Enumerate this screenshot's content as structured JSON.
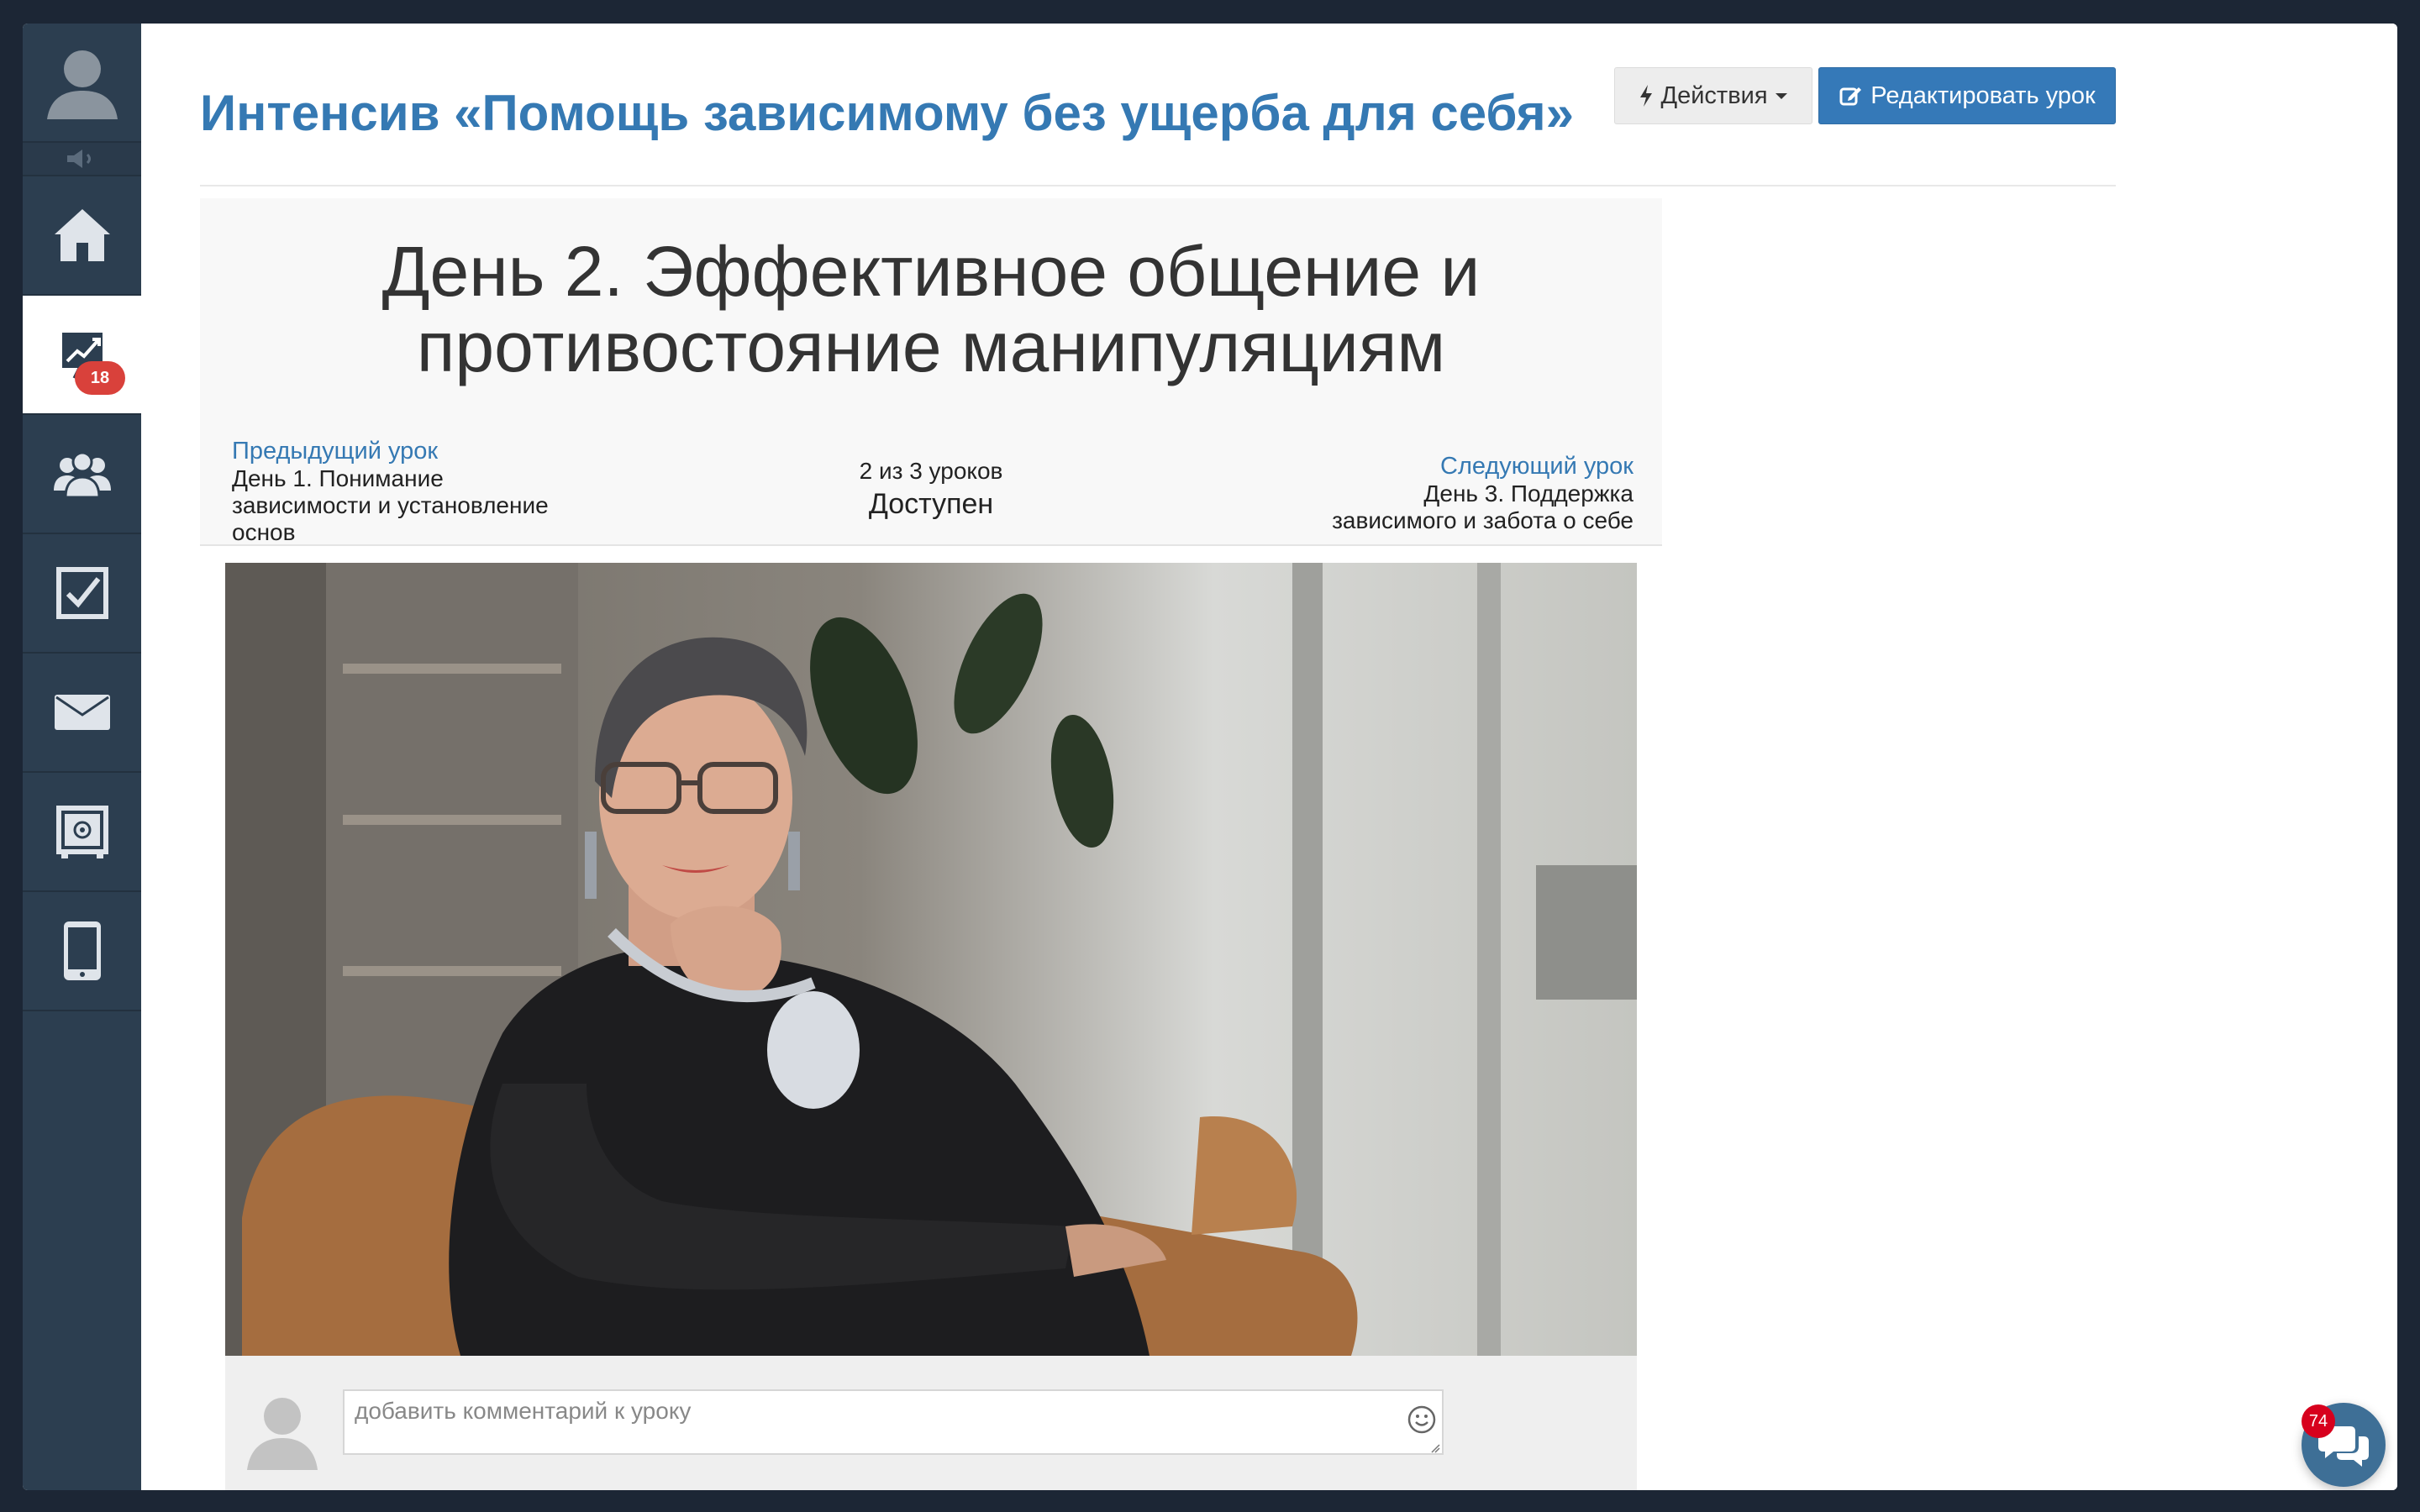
{
  "header": {
    "title": "Интенсив «Помощь зависимому без ущерба для себя»",
    "actions_label": "Действия",
    "edit_label": "Редактировать урок"
  },
  "sidebar": {
    "items": [
      {
        "icon": "home-icon"
      },
      {
        "icon": "trend-chart-icon",
        "badge": "18",
        "active": true
      },
      {
        "icon": "users-icon"
      },
      {
        "icon": "checkbox-icon"
      },
      {
        "icon": "mail-icon"
      },
      {
        "icon": "safe-icon"
      },
      {
        "icon": "mobile-icon"
      }
    ]
  },
  "lesson": {
    "title_line1": "День 2. Эффективное общение и",
    "title_line2": "противостояние манипуляциям",
    "prev_label": "Предыдущий урок",
    "prev_title_line1": "День 1. Понимание",
    "prev_title_line2": "зависимости и установление",
    "prev_title_line3": "основ",
    "counter": "2 из 3 уроков",
    "status": "Доступен",
    "next_label": "Следующий урок",
    "next_title_line1": "День 3. Поддержка",
    "next_title_line2": "зависимого и забота о себе"
  },
  "comment": {
    "placeholder": "добавить комментарий к уроку"
  },
  "chat": {
    "badge": "74"
  },
  "colors": {
    "accent": "#3579b3",
    "sidebar": "#2c3e50",
    "badge": "#d9413b"
  }
}
